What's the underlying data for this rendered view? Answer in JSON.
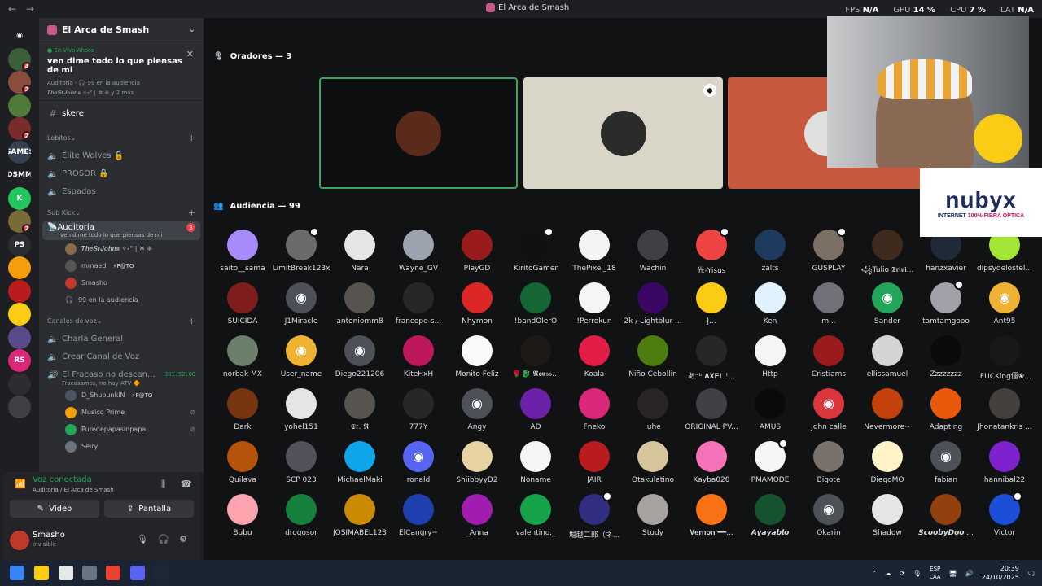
{
  "window": {
    "title": "El Arca de Smash"
  },
  "hud": [
    {
      "label": "FPS",
      "value": "N/A"
    },
    {
      "label": "GPU",
      "value": "14 %"
    },
    {
      "label": "CPU",
      "value": "7 %"
    },
    {
      "label": "LAT",
      "value": "N/A"
    }
  ],
  "rail": [
    {
      "icon": "discord-home-icon",
      "color": "#1e1f22",
      "text": "",
      "badge": ""
    },
    {
      "icon": "server-icon",
      "color": "#3b5f3b",
      "text": "",
      "badge": "4"
    },
    {
      "icon": "server-icon",
      "color": "#8a4d3e",
      "text": "",
      "badge": "2"
    },
    {
      "icon": "server-icon",
      "color": "#4f7a3a",
      "text": "",
      "badge": ""
    },
    {
      "icon": "server-icon",
      "color": "#7a2b2b",
      "text": "",
      "badge": "2"
    },
    {
      "icon": "server-icon",
      "color": "#374151",
      "text": "GAMES",
      "badge": ""
    },
    {
      "icon": "server-icon",
      "color": "#1e1f22",
      "text": "DSMM",
      "badge": ""
    },
    {
      "icon": "server-icon",
      "color": "#22c55e",
      "text": "K",
      "badge": ""
    },
    {
      "icon": "server-icon",
      "color": "#7a6a3a",
      "text": "",
      "badge": "2"
    },
    {
      "icon": "server-icon",
      "color": "#2b2d31",
      "text": "PS",
      "badge": ""
    },
    {
      "icon": "server-icon",
      "color": "#f59e0b",
      "text": "",
      "badge": ""
    },
    {
      "icon": "server-icon",
      "color": "#b91c1c",
      "text": "",
      "badge": ""
    },
    {
      "icon": "server-icon",
      "color": "#facc15",
      "text": "",
      "badge": ""
    },
    {
      "icon": "server-icon",
      "color": "#5b4a8a",
      "text": "",
      "badge": ""
    },
    {
      "icon": "server-icon",
      "color": "#db2777",
      "text": "RS",
      "badge": ""
    },
    {
      "icon": "folder-icon",
      "color": "#2b2d31",
      "text": "",
      "badge": ""
    },
    {
      "icon": "server-icon",
      "color": "#3f3f46",
      "text": "",
      "badge": ""
    }
  ],
  "server": {
    "name": "El Arca de Smash"
  },
  "live": {
    "label": "En Vivo Ahora",
    "title": "ven dime todo lo que piensas de mi",
    "meta": "Auditoria · 🎧 99 en la audiencia",
    "people": "𝑻𝒉𝒆𝑺𝒓𝑱𝒐𝒉𝒏𝒔 ✧˖° | ✲ ❈ y 2 más"
  },
  "channels_top": [
    {
      "icon": "#",
      "label": "skere"
    }
  ],
  "categories": [
    {
      "label": "Lobitos",
      "channels": [
        {
          "icon": "🔈",
          "label": "Elite Wolves 🔒"
        },
        {
          "icon": "🔈",
          "label": "PROSOR 🔒"
        },
        {
          "icon": "🔈",
          "label": "Espadas"
        }
      ]
    },
    {
      "label": "Sub Kick"
    }
  ],
  "stage": {
    "name": "Auditoria",
    "badge": "3",
    "desc": "ven dime todo lo que piensas de mi",
    "members": [
      {
        "name": "𝑻𝒉𝒆𝑺𝒓𝑱𝒐𝒉𝒏𝒔 ✧˖° | ✲ ❈",
        "tag": "",
        "color": "#8a6a4a"
      },
      {
        "name": "mmaed",
        "tag": "⚡P@TO",
        "color": "#555"
      },
      {
        "name": "Smasho",
        "tag": "",
        "color": "#c0392b"
      }
    ],
    "audience": "99 en la audiencia"
  },
  "voice_category": {
    "label": "Canales de voz",
    "channels": [
      {
        "icon": "🔈",
        "label": "Charla General"
      },
      {
        "icon": "🔈",
        "label": "Crear Canal de Voz"
      }
    ],
    "active": {
      "name": "El Fracaso no descan...",
      "timer": "301:52:00",
      "desc": "Fracasamos, no hay ATV 🔶",
      "members": [
        {
          "name": "D_ShubunkiN",
          "tag": "⚡P@TO",
          "color": "#4b5563",
          "icon": ""
        },
        {
          "name": "Musico Prime",
          "tag": "",
          "color": "#f59e0b",
          "icon": "⊘"
        },
        {
          "name": "Purédepapasinpapa",
          "tag": "",
          "color": "#23a55a",
          "icon": "⊘"
        },
        {
          "name": "Seiry",
          "tag": "",
          "color": "#6b7280",
          "icon": ""
        }
      ]
    }
  },
  "voice": {
    "status": "Voz conectada",
    "location": "Auditoria / El Arca de Smash",
    "video": "Vídeo",
    "screen": "Pantalla"
  },
  "user": {
    "name": "Smasho",
    "status": "Invisible"
  },
  "main": {
    "speakers_header": "Oradores — 3",
    "audience_header": "Audiencia — 99"
  },
  "speakers": [
    {
      "bg": "#0e0f10",
      "avatar": "#5a2a1a",
      "border": "#3ba55d",
      "shield": false
    },
    {
      "bg": "#d9d5c7",
      "avatar": "#2b2b2b",
      "border": "",
      "shield": true
    },
    {
      "bg": "#c8583e",
      "avatar": "#e0e0e0",
      "border": "",
      "shield": false
    }
  ],
  "ad": {
    "brand": "nubyx",
    "tagline_a": "INTERNET ",
    "tagline_b": "100% FIBRA ÓPTICA"
  },
  "audience": [
    {
      "name": "saito__sama",
      "color": "#a78bfa",
      "dc": false,
      "badge": false
    },
    {
      "name": "LimitBreak123x",
      "color": "#6b6b6b",
      "dc": false,
      "badge": true
    },
    {
      "name": "Nara",
      "color": "#e5e5e5",
      "dc": false,
      "badge": false
    },
    {
      "name": "Wayne_GV",
      "color": "#9ca3af",
      "dc": false,
      "badge": false
    },
    {
      "name": "PlayGD",
      "color": "#991b1b",
      "dc": false,
      "badge": false
    },
    {
      "name": "KiritoGamer",
      "color": "#111",
      "dc": false,
      "badge": true
    },
    {
      "name": "ThePixel_18",
      "color": "#f3f4f6",
      "dc": false,
      "badge": false
    },
    {
      "name": "Wachin",
      "color": "#3f3f46",
      "dc": false,
      "badge": false
    },
    {
      "name": "光-Yisus",
      "color": "#ef4444",
      "dc": false,
      "badge": true
    },
    {
      "name": "zalts",
      "color": "#1e3a5f",
      "dc": false,
      "badge": false
    },
    {
      "name": "GUSPLAY",
      "color": "#7c6f64",
      "dc": false,
      "badge": true
    },
    {
      "name": "꧁Tulio 𝕿𝖗𝖎𝖛𝖎...",
      "color": "#3f2a1e",
      "dc": false,
      "badge": false
    },
    {
      "name": "hanzxavier",
      "color": "#1f2937",
      "dc": false,
      "badge": false
    },
    {
      "name": "dipsydelostel...",
      "color": "#a3e635",
      "dc": false,
      "badge": false
    },
    {
      "name": "SUICIDA",
      "color": "#7f1d1d",
      "dc": false,
      "badge": false
    },
    {
      "name": "J1Miracle",
      "color": "#4e5058",
      "dc": true,
      "badge": false
    },
    {
      "name": "antoniomm8",
      "color": "#57534e",
      "dc": false,
      "badge": false
    },
    {
      "name": "francope-s...",
      "color": "#27272a",
      "dc": false,
      "badge": false
    },
    {
      "name": "Nhymon",
      "color": "#dc2626",
      "dc": false,
      "badge": false
    },
    {
      "name": "!bandOlerO",
      "color": "#166534",
      "dc": false,
      "badge": false
    },
    {
      "name": "!Perrokun",
      "color": "#f5f5f4",
      "dc": false,
      "badge": false
    },
    {
      "name": "2k / Lightblur ...",
      "color": "#3b0764",
      "dc": false,
      "badge": false
    },
    {
      "name": "J...",
      "color": "#facc15",
      "dc": false,
      "badge": false
    },
    {
      "name": "Ken",
      "color": "#e0f2fe",
      "dc": false,
      "badge": false
    },
    {
      "name": "m...",
      "color": "#71717a",
      "dc": false,
      "badge": false
    },
    {
      "name": "Sander",
      "color": "#23a55a",
      "dc": true,
      "badge": false
    },
    {
      "name": "tamtamgooo",
      "color": "#a1a1aa",
      "dc": false,
      "badge": true
    },
    {
      "name": "Ant95",
      "color": "#f0b232",
      "dc": true,
      "badge": false
    },
    {
      "name": "norbak MX",
      "color": "#6b7f6b",
      "dc": false,
      "badge": false
    },
    {
      "name": "User_name",
      "color": "#f0b232",
      "dc": true,
      "badge": false
    },
    {
      "name": "Diego221206",
      "color": "#4e5058",
      "dc": true,
      "badge": false
    },
    {
      "name": "KiteHxH",
      "color": "#be185d",
      "dc": false,
      "badge": false
    },
    {
      "name": "Monito Feliz",
      "color": "#fafaf9",
      "dc": false,
      "badge": false
    },
    {
      "name": "🌹🐉 𝕽𝖔𝖚𝖘𝖘...",
      "color": "#1c1917",
      "dc": false,
      "badge": false
    },
    {
      "name": "Koala",
      "color": "#e11d48",
      "dc": false,
      "badge": false
    },
    {
      "name": "Niño Cebollin",
      "color": "#4d7c0f",
      "dc": false,
      "badge": false
    },
    {
      "name": "あ⁻ᵇ 𝐀𝐗𝐄𝐋 ᵗ...",
      "color": "#27272a",
      "dc": false,
      "badge": false
    },
    {
      "name": "Http",
      "color": "#f5f5f5",
      "dc": false,
      "badge": false
    },
    {
      "name": "Cristiams",
      "color": "#991b1b",
      "dc": false,
      "badge": false
    },
    {
      "name": "ellissamuel",
      "color": "#d4d4d4",
      "dc": false,
      "badge": false
    },
    {
      "name": "Zzzzzzzz",
      "color": "#0c0a09",
      "dc": false,
      "badge": false
    },
    {
      "name": ".FUCKing僵❀...",
      "color": "#18181b",
      "dc": false,
      "badge": false
    },
    {
      "name": "Dark",
      "color": "#78350f",
      "dc": false,
      "badge": false
    },
    {
      "name": "yohel151",
      "color": "#e7e5e4",
      "dc": false,
      "badge": false
    },
    {
      "name": "𝕰𝖗. 𝕽",
      "color": "#57534e",
      "dc": false,
      "badge": false
    },
    {
      "name": "777Y",
      "color": "#27272a",
      "dc": false,
      "badge": false
    },
    {
      "name": "Angy",
      "color": "#4e5058",
      "dc": true,
      "badge": false
    },
    {
      "name": "AD",
      "color": "#6b21a8",
      "dc": false,
      "badge": false
    },
    {
      "name": "Fneko",
      "color": "#db2777",
      "dc": false,
      "badge": false
    },
    {
      "name": "luhe",
      "color": "#292524",
      "dc": false,
      "badge": false
    },
    {
      "name": "ORIGINAL PV...",
      "color": "#3f3f46",
      "dc": false,
      "badge": false
    },
    {
      "name": "AMUS",
      "color": "#0a0a0a",
      "dc": false,
      "badge": false
    },
    {
      "name": "John calle",
      "color": "#da373c",
      "dc": true,
      "badge": false
    },
    {
      "name": "Nevermore~",
      "color": "#c2410c",
      "dc": false,
      "badge": false
    },
    {
      "name": "Adapting",
      "color": "#ea580c",
      "dc": false,
      "badge": false
    },
    {
      "name": "Jhonatankris ...",
      "color": "#44403c",
      "dc": false,
      "badge": false
    },
    {
      "name": "Quilava",
      "color": "#b45309",
      "dc": false,
      "badge": false
    },
    {
      "name": "SCP 023",
      "color": "#52525b",
      "dc": false,
      "badge": false
    },
    {
      "name": "MichaelMaki",
      "color": "#0ea5e9",
      "dc": false,
      "badge": false
    },
    {
      "name": "ronald",
      "color": "#5865f2",
      "dc": true,
      "badge": false
    },
    {
      "name": "ShiibbyyD2",
      "color": "#e7d3a1",
      "dc": false,
      "badge": false
    },
    {
      "name": "Noname",
      "color": "#f5f5f5",
      "dc": false,
      "badge": false
    },
    {
      "name": "JAIR",
      "color": "#b91c1c",
      "dc": false,
      "badge": false
    },
    {
      "name": "Otakulatino",
      "color": "#d6c49a",
      "dc": false,
      "badge": false
    },
    {
      "name": "Kayba020",
      "color": "#f472b6",
      "dc": false,
      "badge": false
    },
    {
      "name": "PMAMODE",
      "color": "#f5f5f5",
      "dc": false,
      "badge": true
    },
    {
      "name": "Bigote",
      "color": "#78716c",
      "dc": false,
      "badge": false
    },
    {
      "name": "DiegoMO",
      "color": "#fef3c7",
      "dc": false,
      "badge": false
    },
    {
      "name": "fabian",
      "color": "#4e5058",
      "dc": true,
      "badge": false
    },
    {
      "name": "hannibal22",
      "color": "#7e22ce",
      "dc": false,
      "badge": false
    },
    {
      "name": "Bubu",
      "color": "#fda4af",
      "dc": false,
      "badge": false
    },
    {
      "name": "drogosor",
      "color": "#15803d",
      "dc": false,
      "badge": false
    },
    {
      "name": "JOSIMABEL123",
      "color": "#ca8a04",
      "dc": false,
      "badge": false
    },
    {
      "name": "ElCangry~",
      "color": "#1e40af",
      "dc": false,
      "badge": false
    },
    {
      "name": "_Anna",
      "color": "#a21caf",
      "dc": false,
      "badge": false
    },
    {
      "name": "valentino._",
      "color": "#16a34a",
      "dc": false,
      "badge": false
    },
    {
      "name": "堀越二郎（ネ...",
      "color": "#312e81",
      "dc": false,
      "badge": true
    },
    {
      "name": "Study",
      "color": "#a8a29e",
      "dc": false,
      "badge": false
    },
    {
      "name": "𝐕𝐞𝐫𝐧𝐨𝐧 ━━...",
      "color": "#f97316",
      "dc": false,
      "badge": false
    },
    {
      "name": "𝘼𝙮𝙖𝙮𝙖𝙗𝙡𝙤",
      "color": "#14532d",
      "dc": false,
      "badge": false
    },
    {
      "name": "Okarin",
      "color": "#4e5058",
      "dc": true,
      "badge": false
    },
    {
      "name": "Shadow",
      "color": "#e5e5e5",
      "dc": false,
      "badge": false
    },
    {
      "name": "𝙎𝙘𝙤𝙤𝙗𝙮𝘿𝙤𝙤 ...",
      "color": "#92400e",
      "dc": false,
      "badge": false
    },
    {
      "name": "Victor",
      "color": "#1d4ed8",
      "dc": false,
      "badge": true
    }
  ],
  "taskbar": {
    "apps": [
      {
        "icon": "windows-start-icon",
        "color": "#3b82f6"
      },
      {
        "icon": "file-explorer-icon",
        "color": "#facc15"
      },
      {
        "icon": "app-icon",
        "color": "#e5e7eb"
      },
      {
        "icon": "app-icon",
        "color": "#6b7280"
      },
      {
        "icon": "chrome-icon",
        "color": "#ea4335"
      },
      {
        "icon": "discord-icon",
        "color": "#5865f2"
      },
      {
        "icon": "steam-icon",
        "color": "#1b2838"
      }
    ],
    "lang_a": "ESP",
    "lang_b": "LAA",
    "time": "20:39",
    "date": "24/10/2025"
  }
}
